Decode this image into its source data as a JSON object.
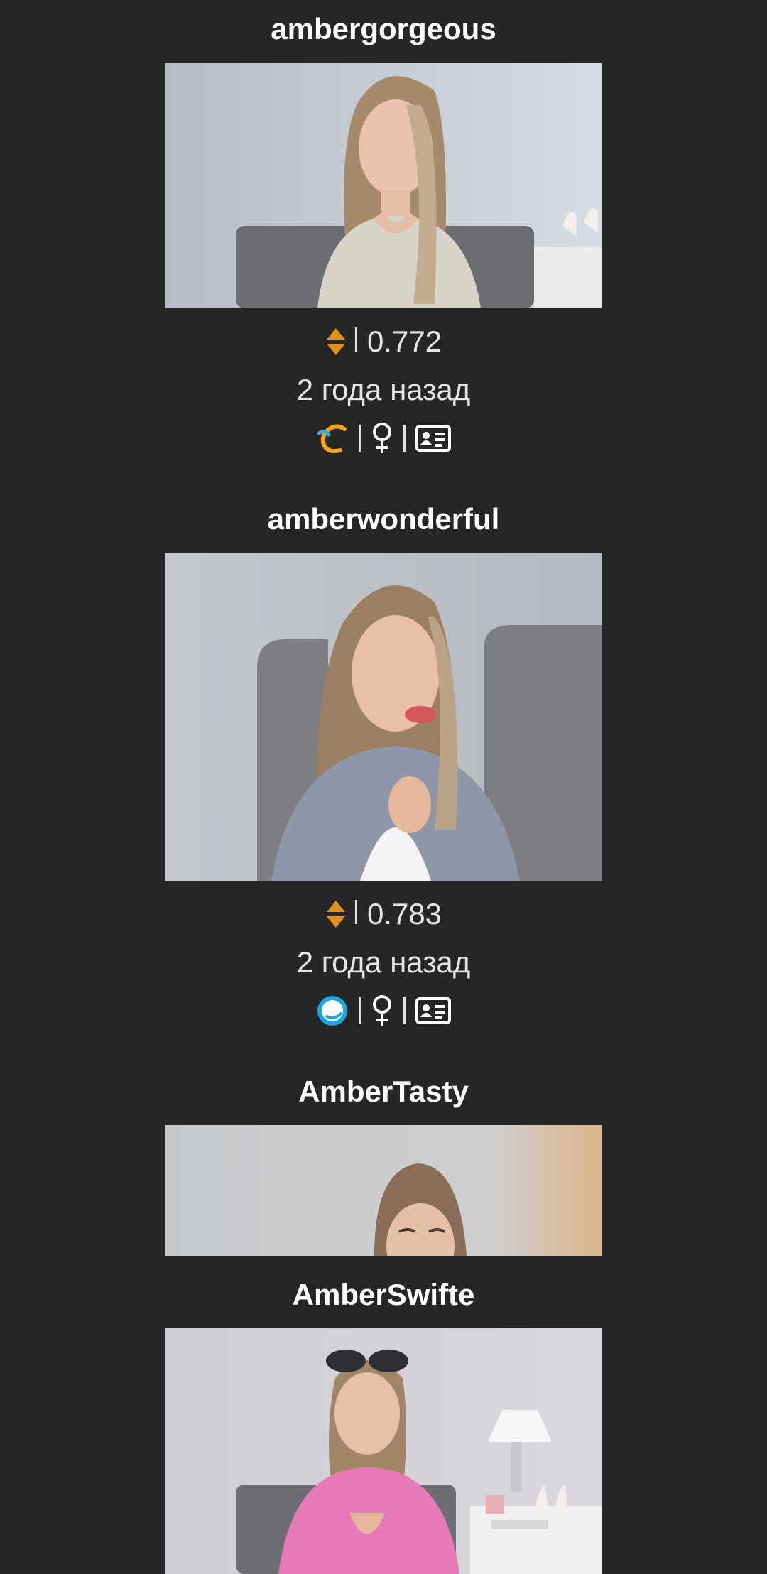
{
  "models": [
    {
      "name": "ambergorgeous",
      "rating": "0.772",
      "time_ago": "2 года назад",
      "platform_icon": "chaturbate-logo-icon",
      "gender_icon": "female-symbol-icon",
      "profile_icon": "id-card-icon"
    },
    {
      "name": "amberwonderful",
      "rating": "0.783",
      "time_ago": "2 года назад",
      "platform_icon": "bubble-logo-icon",
      "gender_icon": "female-symbol-icon",
      "profile_icon": "id-card-icon"
    },
    {
      "name": "AmberTasty"
    },
    {
      "name": "AmberSwifte"
    }
  ],
  "colors": {
    "background": "#262626",
    "rating_arrow": "#e0901c",
    "text": "#ffffff",
    "subtext": "#e6e6e6"
  }
}
